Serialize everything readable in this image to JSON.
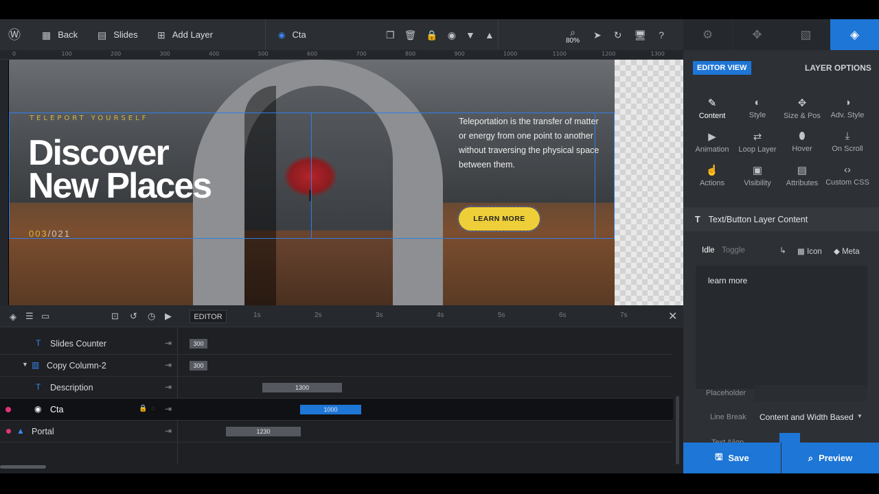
{
  "topbar": {
    "back": "Back",
    "slides": "Slides",
    "add_layer": "Add Layer",
    "selected_layer": "Cta",
    "zoom": "80%"
  },
  "ruler_ticks": [
    "0",
    "100",
    "200",
    "300",
    "400",
    "500",
    "600",
    "700",
    "800",
    "900",
    "1000",
    "1100",
    "1200",
    "1300"
  ],
  "slide": {
    "eyebrow": "TELEPORT YOURSELF",
    "headline_1": "Discover",
    "headline_2": "New Places",
    "counter_current": "003",
    "counter_total": "/021",
    "description": "Teleportation is the transfer of matter or energy from one point to another without traversing the physical space between them.",
    "cta": "LEARN MORE"
  },
  "timeline": {
    "editor_label": "EDITOR",
    "seconds": [
      "1s",
      "2s",
      "3s",
      "4s",
      "5s",
      "6s",
      "7s"
    ],
    "rows": [
      {
        "label": "Slides Counter",
        "duration": "300"
      },
      {
        "label": "Copy Column-2",
        "duration": "300"
      },
      {
        "label": "Description",
        "duration": "1300"
      },
      {
        "label": "Cta",
        "duration": "1000"
      },
      {
        "label": "Portal",
        "duration": "1230"
      }
    ]
  },
  "panel": {
    "editor_view": "EDITOR VIEW",
    "layer_options": "LAYER OPTIONS",
    "options": [
      "Content",
      "Style",
      "Size & Pos",
      "Adv. Style",
      "Animation",
      "Loop Layer",
      "Hover",
      "On Scroll",
      "Actions",
      "Visibility",
      "Attributes",
      "Custom CSS"
    ],
    "section_title": "Text/Button Layer Content",
    "idle": "Idle",
    "toggle": "Toggle",
    "icon": "Icon",
    "meta": "Meta",
    "content_text": "learn more",
    "placeholder_label": "Placeholder",
    "line_break_label": "Line Break",
    "line_break_value": "Content and Width Based",
    "text_align_label": "Text Align",
    "save": "Save",
    "preview": "Preview"
  },
  "colors": {
    "accent": "#1e76d6",
    "cta": "#eecf3a",
    "eyebrow": "#d8b540"
  }
}
